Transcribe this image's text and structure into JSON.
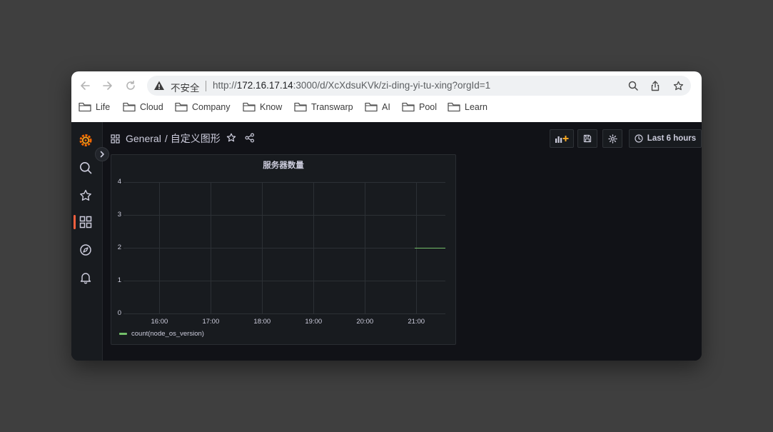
{
  "browser": {
    "security_label": "不安全",
    "url_prefix": "http://",
    "url_host": "172.16.17.14",
    "url_rest": ":3000/d/XcXdsuKVk/zi-ding-yi-tu-xing?orgId=1",
    "bookmarks": [
      "Life",
      "Cloud",
      "Company",
      "Know",
      "Transwarp",
      "AI",
      "Pool",
      "Learn"
    ]
  },
  "dashboard": {
    "folder": "General",
    "separator": "/",
    "title": "自定义图形",
    "time_range": "Last 6 hours"
  },
  "panel": {
    "title": "服务器数量",
    "y_ticks": [
      "4",
      "3",
      "2",
      "1",
      "0"
    ],
    "x_ticks": [
      "16:00",
      "17:00",
      "18:00",
      "19:00",
      "20:00",
      "21:00"
    ],
    "legend": "count(node_os_version)"
  },
  "chart_data": {
    "type": "line",
    "title": "服务器数量",
    "xlabel": "",
    "ylabel": "",
    "ylim": [
      0,
      4
    ],
    "x_ticks": [
      "16:00",
      "17:00",
      "18:00",
      "19:00",
      "20:00",
      "21:00"
    ],
    "grid": true,
    "legend_position": "bottom-left",
    "series": [
      {
        "name": "count(node_os_version)",
        "color": "#73bf69",
        "points": [
          {
            "x": "20:58",
            "y": 2
          },
          {
            "x": "21:34",
            "y": 2
          }
        ]
      }
    ]
  },
  "colors": {
    "accent": "#f55f3e",
    "series_green": "#73bf69",
    "background": "#111217",
    "panel": "#181b1f"
  },
  "icons": {
    "sidebar": [
      "grafana-logo-icon",
      "search-icon",
      "star-icon",
      "dashboards-icon",
      "explore-icon",
      "alerting-bell-icon"
    ],
    "toolbar": [
      "add-panel-icon",
      "save-icon",
      "settings-gear-icon",
      "clock-icon"
    ]
  }
}
